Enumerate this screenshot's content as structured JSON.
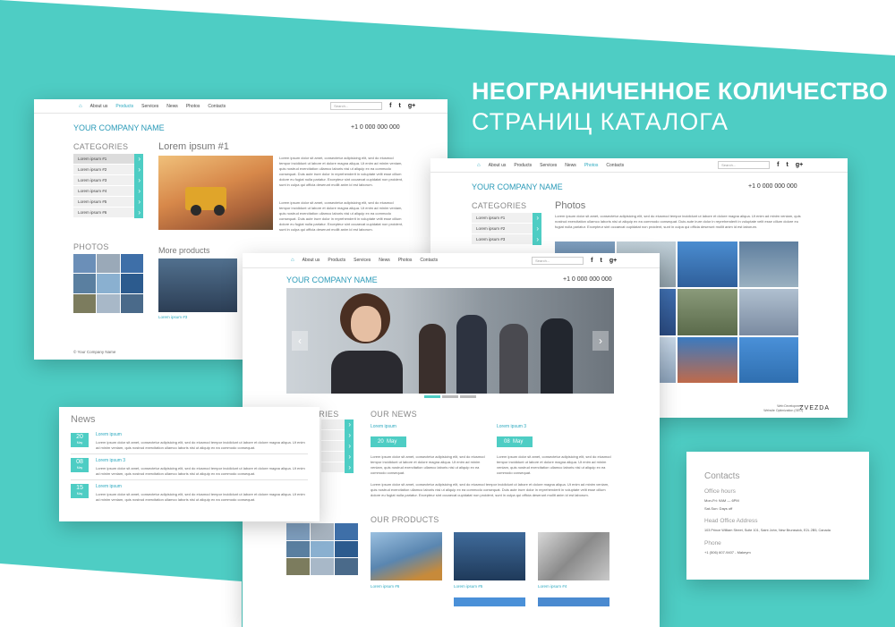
{
  "headline": {
    "line1": "Неограниченное количество",
    "line2": "Страниц каталога"
  },
  "colors": {
    "accent": "#4ecdc4",
    "link": "#2aa8bf",
    "text": "#555555"
  },
  "nav": {
    "items": [
      "About us",
      "Products",
      "Services",
      "News",
      "Photos",
      "Contacts"
    ],
    "search_placeholder": "Search...",
    "social": [
      "f",
      "t",
      "g+"
    ]
  },
  "company_name": "YOUR COMPANY NAME",
  "phone": "+1 0 000 000 000",
  "back_left": {
    "categories_title": "CATEGORIES",
    "categories": [
      "Lorem ipsum #1",
      "Lorem ipsum #2",
      "Lorem ipsum #3",
      "Lorem ipsum #4",
      "Lorem ipsum #5",
      "Lorem ipsum #6"
    ],
    "article_title": "Lorem ipsum #1",
    "photos_title": "PHOTOS",
    "more_products_title": "More products",
    "product_caption": "Lorem ipsum #3",
    "footer": "© Your Company Name"
  },
  "back_right": {
    "categories_title": "CATEGORIES",
    "categories": [
      "Lorem ipsum #1",
      "Lorem ipsum #2",
      "Lorem ipsum #3"
    ],
    "photos_title": "Photos",
    "credit_line1": "Web Development",
    "credit_line2": "Website Optimization (SEO)",
    "credit_brand": "ZVEZDA"
  },
  "front": {
    "categories_title": "ORIES",
    "news_title": "OUR NEWS",
    "news": [
      {
        "title": "Lorem ipsum",
        "day": "20",
        "month": "May"
      },
      {
        "title": "Lorem ipsum 3",
        "day": "08",
        "month": "May"
      }
    ],
    "products_title": "OUR PRODUCTS",
    "products": [
      "Lorem ipsum #6",
      "Lorem ipsum #5",
      "Lorem ipsum #4"
    ]
  },
  "news_card": {
    "title": "News",
    "items": [
      {
        "title": "Lorem ipsum",
        "day": "20",
        "month": "May"
      },
      {
        "title": "Lorem ipsum 3",
        "day": "08",
        "month": "May"
      },
      {
        "title": "Lorem ipsum",
        "day": "15",
        "month": "May"
      }
    ]
  },
  "contacts_card": {
    "title": "Contacts",
    "office_hours_label": "Office hours",
    "office_hours_1": "Mon-Fri: 9AM — 6PM",
    "office_hours_2": "Sat-Sun: Days off",
    "address_label": "Head Office Address",
    "address": "103 Prince William Street, Suite 101, Saint John, New Brunswick, E2L 2B5, Canada",
    "phone_label": "Phone",
    "phone": "+1 (506) 607-9407 - Makeym"
  },
  "lorem_short": "Lorem ipsum dolor sit amet, consectetur adipisicing elit, sed do eiusmod tempor incididunt ut labore et dolore magna aliqua. Ut enim ad minim veniam, quis nostrud exercitation ullamco laboris nisi ut aliquip ex ea commodo consequat.",
  "lorem_long": "Lorem ipsum dolor sit amet, consectetur adipisicing elit, sed do eiusmod tempor incididunt ut labore et dolore magna aliqua. Ut enim ad minim veniam, quis nostrud exercitation ullamco laboris nisi ut aliquip ex ea commodo consequat. Duis aute irure dolor in reprehenderit in voluptate velit esse cillum dolore eu fugiat nulla pariatur. Excepteur sint occaecat cupidatat non proident, sunt in culpa qui officia deserunt mollit anim id est laborum."
}
